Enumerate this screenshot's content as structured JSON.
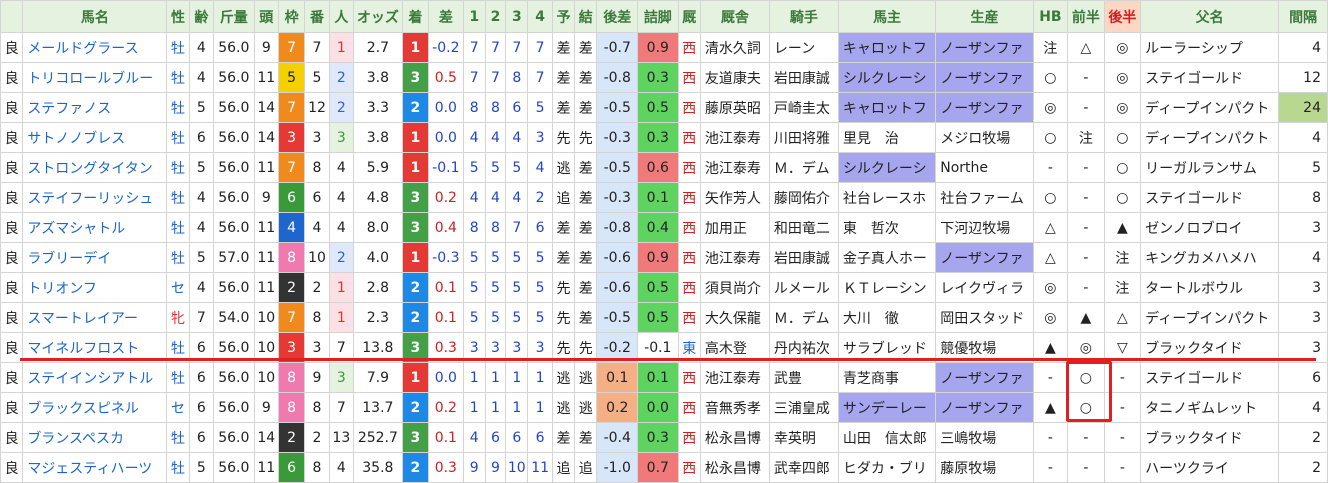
{
  "headers": [
    "",
    "馬名",
    "性",
    "齢",
    "斤量",
    "頭",
    "枠",
    "番",
    "人",
    "オッズ",
    "着",
    "差",
    "1",
    "2",
    "3",
    "4",
    "予",
    "結",
    "後差",
    "詰脚",
    "厩",
    "厩舎",
    "騎手",
    "馬主",
    "生産",
    "HB",
    "前半",
    "後半",
    "父名",
    "間隔"
  ],
  "rows": [
    {
      "cond": "良",
      "name": "メールドグラース",
      "sex": "牡",
      "age": "4",
      "weight": "56.0",
      "heads": "9",
      "frame": "7",
      "num": "7",
      "pop": "1",
      "odds": "2.7",
      "finish": "1",
      "diff": "-0.2",
      "c1": "7",
      "c2": "7",
      "c3": "7",
      "c4": "7",
      "pred": "差",
      "res": "差",
      "back": "-0.7",
      "kick": "0.9",
      "region": "西",
      "trainer": "清水久詞",
      "jockey": "レーン",
      "owner": "キャロットフ",
      "breeder": "ノーザンファ",
      "hb": "注",
      "first": "△",
      "second": "◎",
      "sire": "ルーラーシップ",
      "gap": "4"
    },
    {
      "cond": "良",
      "name": "トリコロールブルー",
      "sex": "牡",
      "age": "4",
      "weight": "56.0",
      "heads": "11",
      "frame": "5",
      "num": "5",
      "pop": "2",
      "odds": "3.8",
      "finish": "3",
      "diff": "0.5",
      "c1": "7",
      "c2": "7",
      "c3": "8",
      "c4": "7",
      "pred": "差",
      "res": "差",
      "back": "-0.8",
      "kick": "0.3",
      "region": "西",
      "trainer": "友道康夫",
      "jockey": "岩田康誠",
      "owner": "シルクレーシ",
      "breeder": "ノーザンファ",
      "hb": "○",
      "first": "-",
      "second": "◎",
      "sire": "ステイゴールド",
      "gap": "12"
    },
    {
      "cond": "良",
      "name": "ステファノス",
      "sex": "牡",
      "age": "5",
      "weight": "56.0",
      "heads": "14",
      "frame": "7",
      "num": "12",
      "pop": "2",
      "odds": "3.3",
      "finish": "2",
      "diff": "0.0",
      "c1": "8",
      "c2": "8",
      "c3": "6",
      "c4": "5",
      "pred": "差",
      "res": "差",
      "back": "-0.5",
      "kick": "0.5",
      "region": "西",
      "trainer": "藤原英昭",
      "jockey": "戸崎圭太",
      "owner": "キャロットフ",
      "breeder": "ノーザンファ",
      "hb": "◎",
      "first": "-",
      "second": "◎",
      "sire": "ディープインパクト",
      "gap": "24"
    },
    {
      "cond": "良",
      "name": "サトノノブレス",
      "sex": "牡",
      "age": "6",
      "weight": "56.0",
      "heads": "14",
      "frame": "3",
      "num": "3",
      "pop": "3",
      "odds": "3.8",
      "finish": "1",
      "diff": "0.0",
      "c1": "4",
      "c2": "4",
      "c3": "4",
      "c4": "3",
      "pred": "先",
      "res": "先",
      "back": "-0.3",
      "kick": "0.3",
      "region": "西",
      "trainer": "池江泰寿",
      "jockey": "川田将雅",
      "owner": "里見　治",
      "breeder": "メジロ牧場",
      "hb": "○",
      "first": "注",
      "second": "○",
      "sire": "ディープインパクト",
      "gap": "4"
    },
    {
      "cond": "良",
      "name": "ストロングタイタン",
      "sex": "牡",
      "age": "5",
      "weight": "56.0",
      "heads": "11",
      "frame": "7",
      "num": "8",
      "pop": "4",
      "odds": "5.9",
      "finish": "1",
      "diff": "-0.1",
      "c1": "5",
      "c2": "5",
      "c3": "5",
      "c4": "4",
      "pred": "逃",
      "res": "差",
      "back": "-0.5",
      "kick": "0.6",
      "region": "西",
      "trainer": "池江泰寿",
      "jockey": "Ｍ．デム",
      "owner": "シルクレーシ",
      "breeder": "Northe",
      "hb": "-",
      "first": "-",
      "second": "○",
      "sire": "リーガルランサム",
      "gap": "5"
    },
    {
      "cond": "良",
      "name": "ステイフーリッシュ",
      "sex": "牡",
      "age": "4",
      "weight": "56.0",
      "heads": "9",
      "frame": "6",
      "num": "6",
      "pop": "4",
      "odds": "4.8",
      "finish": "3",
      "diff": "0.2",
      "c1": "4",
      "c2": "4",
      "c3": "4",
      "c4": "2",
      "pred": "追",
      "res": "差",
      "back": "-0.3",
      "kick": "0.1",
      "region": "西",
      "trainer": "矢作芳人",
      "jockey": "藤岡佑介",
      "owner": "社台レースホ",
      "breeder": "社台ファーム",
      "hb": "○",
      "first": "-",
      "second": "○",
      "sire": "ステイゴールド",
      "gap": "8"
    },
    {
      "cond": "良",
      "name": "アズマシャトル",
      "sex": "牡",
      "age": "4",
      "weight": "56.0",
      "heads": "11",
      "frame": "4",
      "num": "4",
      "pop": "4",
      "odds": "8.0",
      "finish": "3",
      "diff": "0.4",
      "c1": "8",
      "c2": "8",
      "c3": "7",
      "c4": "6",
      "pred": "差",
      "res": "差",
      "back": "-0.8",
      "kick": "0.4",
      "region": "西",
      "trainer": "加用正",
      "jockey": "和田竜二",
      "owner": "東　哲次",
      "breeder": "下河辺牧場",
      "hb": "△",
      "first": "-",
      "second": "▲",
      "sire": "ゼンノロブロイ",
      "gap": "3"
    },
    {
      "cond": "良",
      "name": "ラブリーデイ",
      "sex": "牡",
      "age": "5",
      "weight": "57.0",
      "heads": "11",
      "frame": "8",
      "num": "10",
      "pop": "2",
      "odds": "4.0",
      "finish": "1",
      "diff": "-0.3",
      "c1": "5",
      "c2": "5",
      "c3": "5",
      "c4": "5",
      "pred": "差",
      "res": "差",
      "back": "-0.6",
      "kick": "0.9",
      "region": "西",
      "trainer": "池江泰寿",
      "jockey": "岩田康誠",
      "owner": "金子真人ホー",
      "breeder": "ノーザンファ",
      "hb": "△",
      "first": "-",
      "second": "注",
      "sire": "キングカメハメハ",
      "gap": "4"
    },
    {
      "cond": "良",
      "name": "トリオンフ",
      "sex": "セ",
      "age": "4",
      "weight": "56.0",
      "heads": "11",
      "frame": "2",
      "num": "2",
      "pop": "1",
      "odds": "2.8",
      "finish": "2",
      "diff": "0.1",
      "c1": "5",
      "c2": "5",
      "c3": "5",
      "c4": "5",
      "pred": "先",
      "res": "差",
      "back": "-0.6",
      "kick": "0.5",
      "region": "西",
      "trainer": "須貝尚介",
      "jockey": "ルメール",
      "owner": "ＫＴレーシン",
      "breeder": "レイクヴィラ",
      "hb": "◎",
      "first": "-",
      "second": "注",
      "sire": "タートルボウル",
      "gap": "3"
    },
    {
      "cond": "良",
      "name": "スマートレイアー",
      "sex": "牝",
      "age": "7",
      "weight": "54.0",
      "heads": "10",
      "frame": "7",
      "num": "8",
      "pop": "1",
      "odds": "2.3",
      "finish": "2",
      "diff": "0.1",
      "c1": "5",
      "c2": "5",
      "c3": "5",
      "c4": "5",
      "pred": "先",
      "res": "差",
      "back": "-0.5",
      "kick": "0.5",
      "region": "西",
      "trainer": "大久保龍",
      "jockey": "Ｍ．デム",
      "owner": "大川　徹",
      "breeder": "岡田スタッド",
      "hb": "◎",
      "first": "▲",
      "second": "△",
      "sire": "ディープインパクト",
      "gap": "3"
    },
    {
      "cond": "良",
      "name": "マイネルフロスト",
      "sex": "牡",
      "age": "6",
      "weight": "56.0",
      "heads": "10",
      "frame": "3",
      "num": "3",
      "pop": "7",
      "odds": "13.8",
      "finish": "3",
      "diff": "0.3",
      "c1": "3",
      "c2": "3",
      "c3": "3",
      "c4": "3",
      "pred": "先",
      "res": "先",
      "back": "-0.2",
      "kick": "-0.1",
      "region": "東",
      "trainer": "高木登",
      "jockey": "丹内祐次",
      "owner": "サラブレッド",
      "breeder": "競優牧場",
      "hb": "▲",
      "first": "◎",
      "second": "▽",
      "sire": "ブラックタイド",
      "gap": "3"
    },
    {
      "cond": "良",
      "name": "ステイインシアトル",
      "sex": "牡",
      "age": "6",
      "weight": "56.0",
      "heads": "10",
      "frame": "8",
      "num": "9",
      "pop": "3",
      "odds": "7.9",
      "finish": "1",
      "diff": "0.0",
      "c1": "1",
      "c2": "1",
      "c3": "1",
      "c4": "1",
      "pred": "逃",
      "res": "逃",
      "back": "0.1",
      "kick": "0.1",
      "region": "西",
      "trainer": "池江泰寿",
      "jockey": "武豊",
      "owner": "青芝商事",
      "breeder": "ノーザンファ",
      "hb": "-",
      "first": "○",
      "second": "-",
      "sire": "ステイゴールド",
      "gap": "6"
    },
    {
      "cond": "良",
      "name": "ブラックスピネル",
      "sex": "セ",
      "age": "6",
      "weight": "56.0",
      "heads": "9",
      "frame": "8",
      "num": "8",
      "pop": "7",
      "odds": "13.7",
      "finish": "2",
      "diff": "0.2",
      "c1": "1",
      "c2": "1",
      "c3": "1",
      "c4": "1",
      "pred": "逃",
      "res": "逃",
      "back": "0.2",
      "kick": "0.0",
      "region": "西",
      "trainer": "音無秀孝",
      "jockey": "三浦皇成",
      "owner": "サンデーレー",
      "breeder": "ノーザンファ",
      "hb": "▲",
      "first": "○",
      "second": "-",
      "sire": "タニノギムレット",
      "gap": "4"
    },
    {
      "cond": "良",
      "name": "ブランスペスカ",
      "sex": "牡",
      "age": "6",
      "weight": "56.0",
      "heads": "14",
      "frame": "2",
      "num": "2",
      "pop": "13",
      "odds": "252.7",
      "finish": "3",
      "diff": "0.1",
      "c1": "4",
      "c2": "6",
      "c3": "6",
      "c4": "6",
      "pred": "差",
      "res": "差",
      "back": "-0.4",
      "kick": "0.3",
      "region": "西",
      "trainer": "松永昌博",
      "jockey": "幸英明",
      "owner": "山田　信太郎",
      "breeder": "三嶋牧場",
      "hb": "-",
      "first": "-",
      "second": "-",
      "sire": "ブラックタイド",
      "gap": "2"
    },
    {
      "cond": "良",
      "name": "マジェスティハーツ",
      "sex": "牡",
      "age": "5",
      "weight": "56.0",
      "heads": "11",
      "frame": "6",
      "num": "8",
      "pop": "4",
      "odds": "35.8",
      "finish": "2",
      "diff": "0.3",
      "c1": "9",
      "c2": "9",
      "c3": "10",
      "c4": "11",
      "pred": "追",
      "res": "追",
      "back": "-1.0",
      "kick": "0.7",
      "region": "西",
      "trainer": "松永昌博",
      "jockey": "武幸四郎",
      "owner": "ヒダカ・ブリ",
      "breeder": "藤原牧場",
      "hb": "-",
      "first": "-",
      "second": "-",
      "sire": "ハーツクライ",
      "gap": "2"
    }
  ]
}
